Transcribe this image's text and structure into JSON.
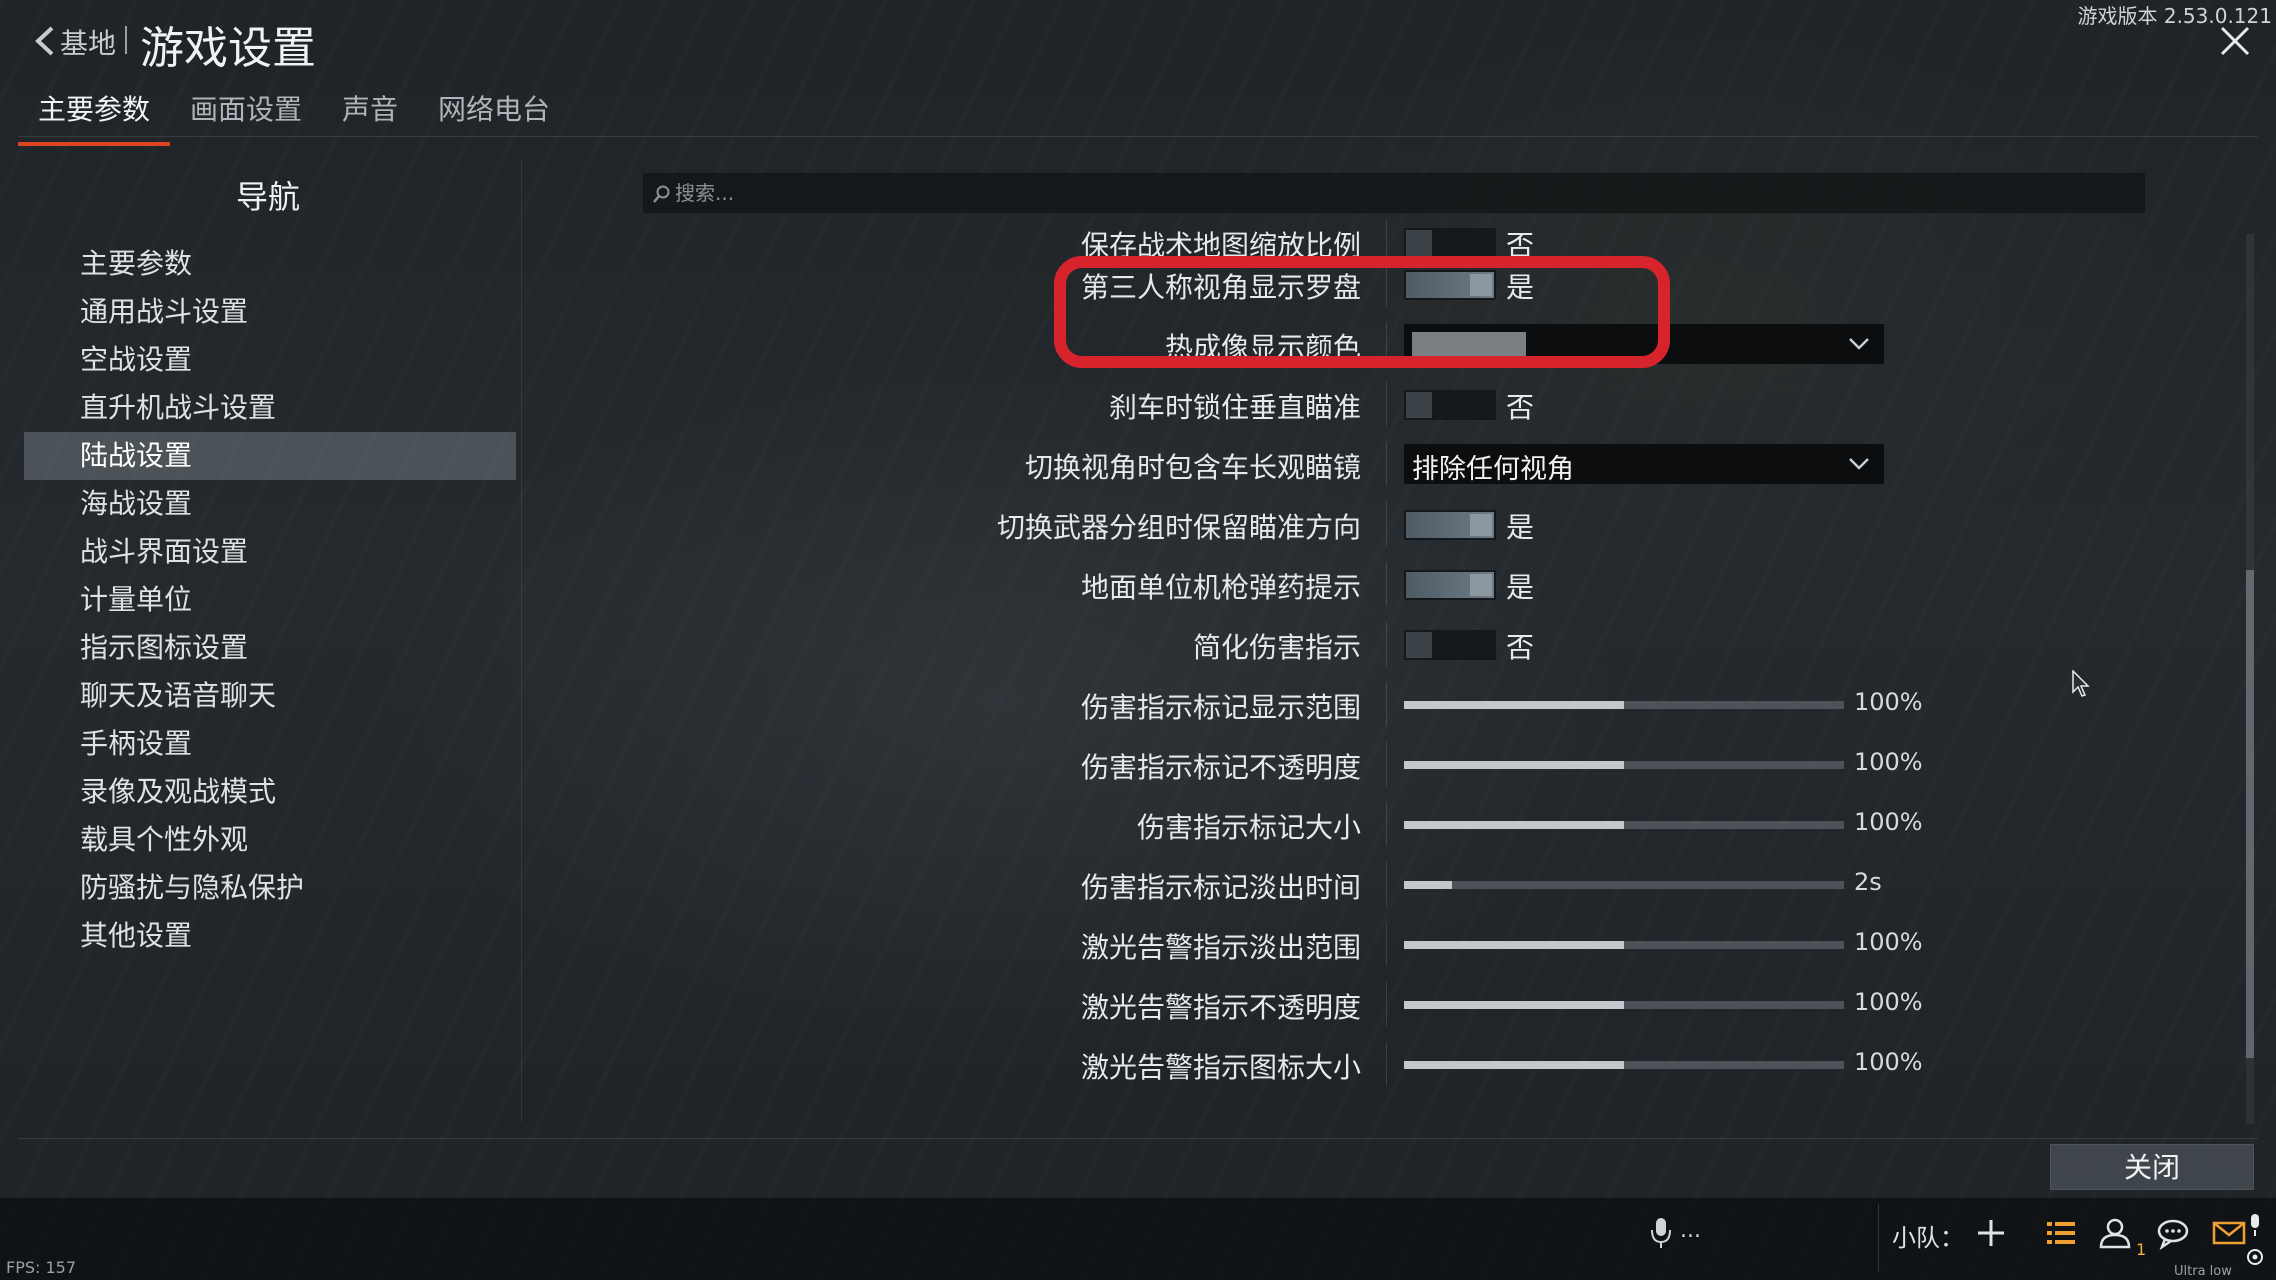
{
  "header": {
    "back_label": "基地",
    "title": "游戏设置",
    "version": "游戏版本 2.53.0.121"
  },
  "tabs": [
    {
      "label": "主要参数",
      "active": true
    },
    {
      "label": "画面设置",
      "active": false
    },
    {
      "label": "声音",
      "active": false
    },
    {
      "label": "网络电台",
      "active": false
    }
  ],
  "nav": {
    "title": "导航",
    "items": [
      {
        "label": "主要参数"
      },
      {
        "label": "通用战斗设置"
      },
      {
        "label": "空战设置"
      },
      {
        "label": "直升机战斗设置"
      },
      {
        "label": "陆战设置",
        "active": true
      },
      {
        "label": "海战设置"
      },
      {
        "label": "战斗界面设置"
      },
      {
        "label": "计量单位"
      },
      {
        "label": "指示图标设置"
      },
      {
        "label": "聊天及语音聊天"
      },
      {
        "label": "手柄设置"
      },
      {
        "label": "录像及观战模式"
      },
      {
        "label": "载具个性外观"
      },
      {
        "label": "防骚扰与隐私保护"
      },
      {
        "label": "其他设置"
      }
    ]
  },
  "search": {
    "placeholder": "搜索..."
  },
  "settings": [
    {
      "label": "保存战术地图缩放比例",
      "type": "toggle",
      "on": false,
      "state": "否"
    },
    {
      "label": "第三人称视角显示罗盘",
      "type": "toggle",
      "on": true,
      "state": "是"
    },
    {
      "label": "热成像显示颜色",
      "type": "select-swatch",
      "swatch": "#7a7f84"
    },
    {
      "label": "刹车时锁住垂直瞄准",
      "type": "toggle",
      "on": false,
      "state": "否"
    },
    {
      "label": "切换视角时包含车长观瞄镜",
      "type": "select",
      "value": "排除任何视角"
    },
    {
      "label": "切换武器分组时保留瞄准方向",
      "type": "toggle",
      "on": true,
      "state": "是"
    },
    {
      "label": "地面单位机枪弹药提示",
      "type": "toggle",
      "on": true,
      "state": "是"
    },
    {
      "label": "简化伤害指示",
      "type": "toggle",
      "on": false,
      "state": "否"
    },
    {
      "label": "伤害指示标记显示范围",
      "type": "slider",
      "level": 0.5,
      "value": "100%"
    },
    {
      "label": "伤害指示标记不透明度",
      "type": "slider",
      "level": 0.5,
      "value": "100%"
    },
    {
      "label": "伤害指示标记大小",
      "type": "slider",
      "level": 0.5,
      "value": "100%"
    },
    {
      "label": "伤害指示标记淡出时间",
      "type": "slider",
      "level": 0.11,
      "value": "2s"
    },
    {
      "label": "激光告警指示淡出范围",
      "type": "slider",
      "level": 0.5,
      "value": "100%"
    },
    {
      "label": "激光告警指示不透明度",
      "type": "slider",
      "level": 0.5,
      "value": "100%"
    },
    {
      "label": "激光告警指示图标大小",
      "type": "slider",
      "level": 0.5,
      "value": "100%"
    }
  ],
  "footer": {
    "close_label": "关闭",
    "fps": "FPS: 157",
    "mic_status": "...",
    "squad_label": "小队：",
    "friend_count": "1",
    "quality": "Ultra low quality"
  },
  "colors": {
    "accent": "#e0431f",
    "highlight": "#d7242c"
  }
}
